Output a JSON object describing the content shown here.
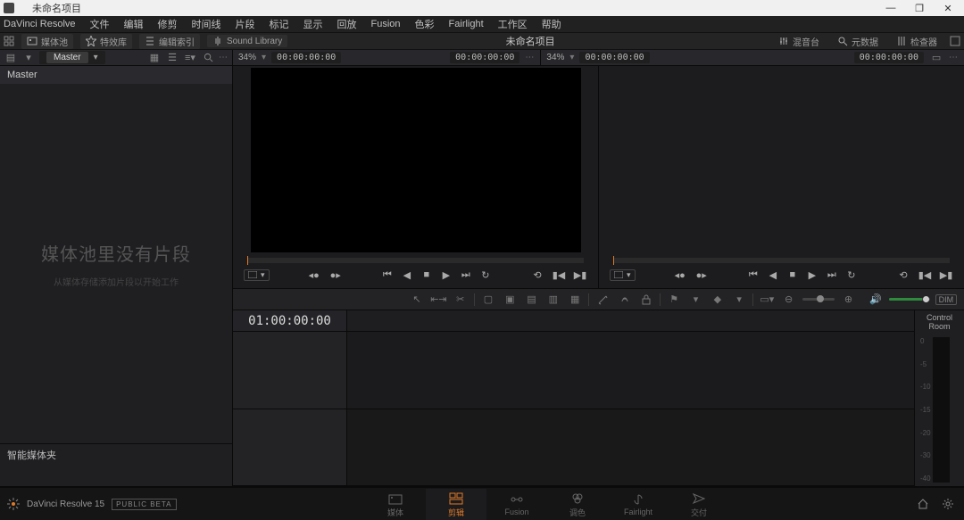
{
  "titlebar": {
    "title": "未命名项目"
  },
  "menubar": {
    "app_name": "DaVinci Resolve",
    "items": [
      "文件",
      "编辑",
      "修剪",
      "时间线",
      "片段",
      "标记",
      "显示",
      "回放",
      "Fusion",
      "色彩",
      "Fairlight",
      "工作区",
      "帮助"
    ]
  },
  "sectoolbar": {
    "media_pool": "媒体池",
    "effects": "特效库",
    "edit_index": "编辑索引",
    "sound_library": "Sound Library",
    "center_title": "未命名项目",
    "mixer": "混音台",
    "metadata": "元数据",
    "inspector": "检查器"
  },
  "ctrlbar": {
    "bin_label": "Master",
    "zoom_left": "34%",
    "tc_left": "00:00:00:00",
    "zoom_right": "34%",
    "tc_right": "00:00:00:00",
    "tc_record": "00:00:00:00"
  },
  "mediapool": {
    "bin_name": "Master",
    "empty_msg": "媒体池里没有片段",
    "empty_hint": "从媒体存储添加片段以开始工作",
    "smart_bin": "智能媒体夹"
  },
  "timeline": {
    "tc": "01:00:00:00"
  },
  "controlroom": {
    "label": "Control Room",
    "ticks": [
      "0",
      "-5",
      "-10",
      "-15",
      "-20",
      "-30",
      "-40"
    ]
  },
  "edittoolbar": {
    "dim_label": "DIM"
  },
  "pagetabs": {
    "version": "DaVinci Resolve 15",
    "beta": "PUBLIC BETA",
    "tabs": [
      {
        "k": "media",
        "label": "媒体"
      },
      {
        "k": "edit",
        "label": "剪辑"
      },
      {
        "k": "fusion",
        "label": "Fusion"
      },
      {
        "k": "color",
        "label": "调色"
      },
      {
        "k": "fairlight",
        "label": "Fairlight"
      },
      {
        "k": "deliver",
        "label": "交付"
      }
    ],
    "active": "edit"
  }
}
